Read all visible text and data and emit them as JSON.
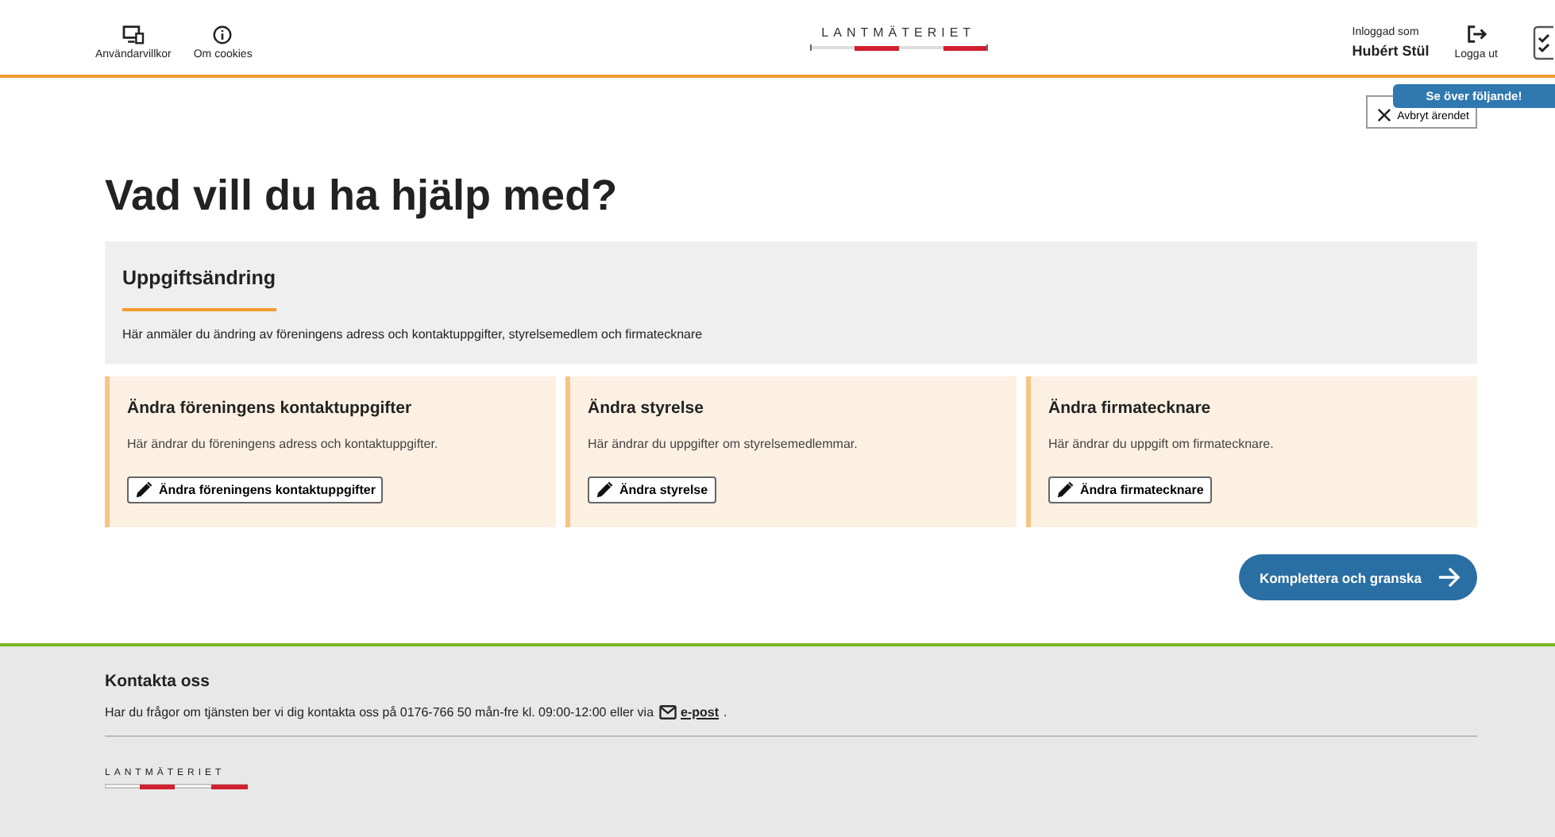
{
  "header": {
    "links": [
      {
        "kind": "terms",
        "label": "Användarvillkor"
      },
      {
        "kind": "info",
        "label": "Om cookies"
      }
    ],
    "logo": "LANTMÄTERIET",
    "user": {
      "caption": "Inloggad som",
      "name": "Hubért Stül"
    },
    "logout": "Logga ut"
  },
  "tooltip": "Se över följande!",
  "cancel_button": "Avbryt ärendet",
  "heading": "Vad vill du ha hjälp med?",
  "section": {
    "title": "Uppgiftsändring",
    "description": "Här anmäler du ändring av föreningens adress och kontaktuppgifter, styrelsemedlem och firmatecknare"
  },
  "cards": [
    {
      "title": "Ändra föreningens kontaktuppgifter",
      "text": "Här ändrar du föreningens adress och kontaktuppgifter.",
      "button": "Ändra föreningens kontaktuppgifter"
    },
    {
      "title": "Ändra styrelse",
      "text": "Här ändrar du uppgifter om styrelsemedlemmar.",
      "button": "Ändra styrelse"
    },
    {
      "title": "Ändra firmatecknare",
      "text": "Här ändrar du uppgift om firmatecknare.",
      "button": "Ändra firmatecknare"
    }
  ],
  "next_button": "Komplettera och granska",
  "footer": {
    "title": "Kontakta oss",
    "text": "Har du frågor om tjänsten ber vi dig kontakta oss på 0176-766 50 mån-fre kl. 09:00-12:00 eller via",
    "link": "e-post",
    "after": ".",
    "logo": "LANTMÄTERIET"
  }
}
